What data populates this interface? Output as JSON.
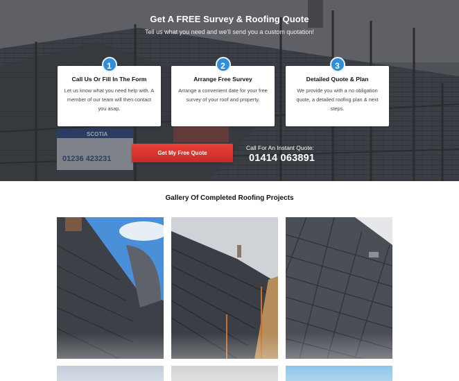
{
  "hero": {
    "title": "Get A FREE Survey & Roofing Quote",
    "subtitle": "Tell us what you need and we'll send you a custom quotation!",
    "steps": [
      {
        "number": "1",
        "title": "Call Us Or Fill In The Form",
        "text": "Let us know what you need help with. A member of our team will then contact you asap."
      },
      {
        "number": "2",
        "title": "Arrange Free Survey",
        "text": "Arrange a convenient date for your free survey of your roof and property."
      },
      {
        "number": "3",
        "title": "Detailed Quote & Plan",
        "text": "We provide you with a no obligation quote, a detailed roofing plan & next steps."
      }
    ],
    "cta_label": "Get My Free Quote",
    "call_label": "Call For An Instant Quote:",
    "phone": "01414 063891",
    "banner_phone": "01236 423231",
    "banner_brand": "SCOTIA"
  },
  "gallery": {
    "title": "Gallery Of Completed Roofing Projects",
    "images": [
      {
        "name": "roof-photo-1"
      },
      {
        "name": "roof-photo-2"
      },
      {
        "name": "roof-photo-3"
      },
      {
        "name": "roof-photo-4"
      },
      {
        "name": "roof-photo-5"
      },
      {
        "name": "roof-photo-6"
      }
    ]
  },
  "colors": {
    "accent_blue": "#2f8fd8",
    "cta_red": "#d9332e",
    "hero_overlay": "#3c3f44"
  }
}
